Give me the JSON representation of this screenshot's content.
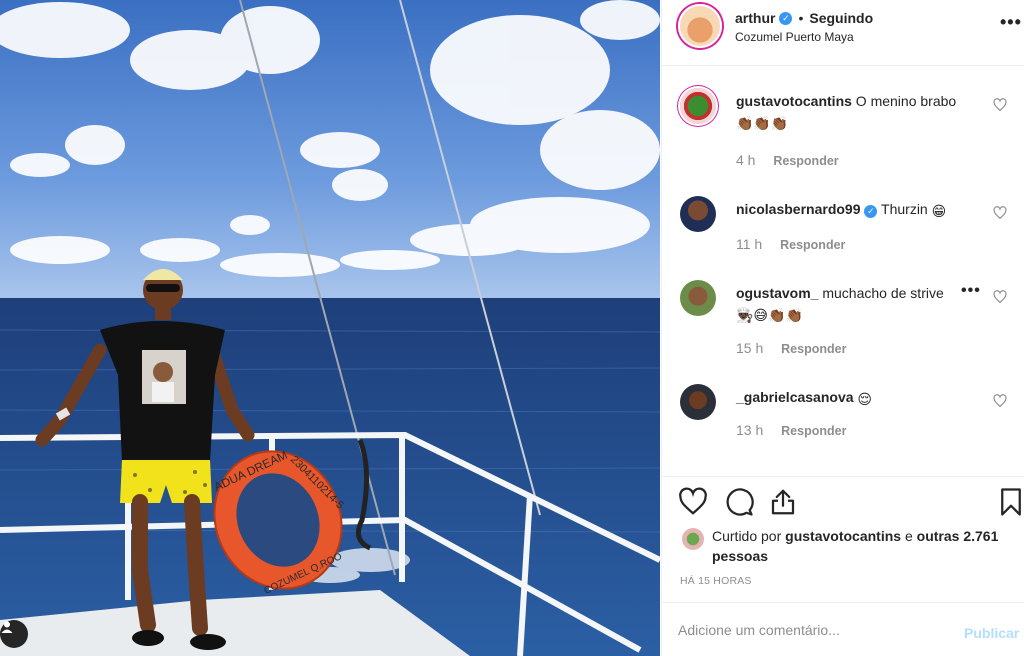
{
  "post": {
    "username": "arthur",
    "follow_status": "Seguindo",
    "separator": "•",
    "location": "Cozumel Puerto Maya",
    "more_icon": "more-dots-icon"
  },
  "comments": [
    {
      "user": "gustavotocantins",
      "text": "O menino brabo",
      "emojis": "👏🏾👏🏾👏🏾",
      "time": "4 h",
      "reply": "Responder",
      "verified": false
    },
    {
      "user": "nicolasbernardo99",
      "text": "Thurzin",
      "emojis": "😁",
      "time": "11 h",
      "reply": "Responder",
      "verified": true
    },
    {
      "user": "ogustavom_",
      "text": "muchacho de strive",
      "emojis": "👨🏿‍🍳😅👏🏾👏🏾",
      "time": "15 h",
      "reply": "Responder",
      "verified": false
    },
    {
      "user": "_gabrielcasanova",
      "text": "",
      "emojis": "😌",
      "time": "13 h",
      "reply": "Responder",
      "verified": false
    }
  ],
  "likes": {
    "prefix": "Curtido por",
    "top_user": "gustavotocantins",
    "connector": "e",
    "others": "outras 2.761 pessoas"
  },
  "timestamp": "HÁ 15 HORAS",
  "composer": {
    "placeholder": "Adicione um comentário...",
    "publish_label": "Publicar"
  },
  "photo": {
    "lifebuoy_text": "ADUA DREAM",
    "lifebuoy_number": "2304110214-5",
    "lifebuoy_city": "COZUMEL Q.ROO"
  },
  "colors": {
    "accent_blue": "#3897f0",
    "muted_text": "#8e8e8e",
    "publish_disabled": "#b2dffc",
    "border": "#efefef"
  }
}
